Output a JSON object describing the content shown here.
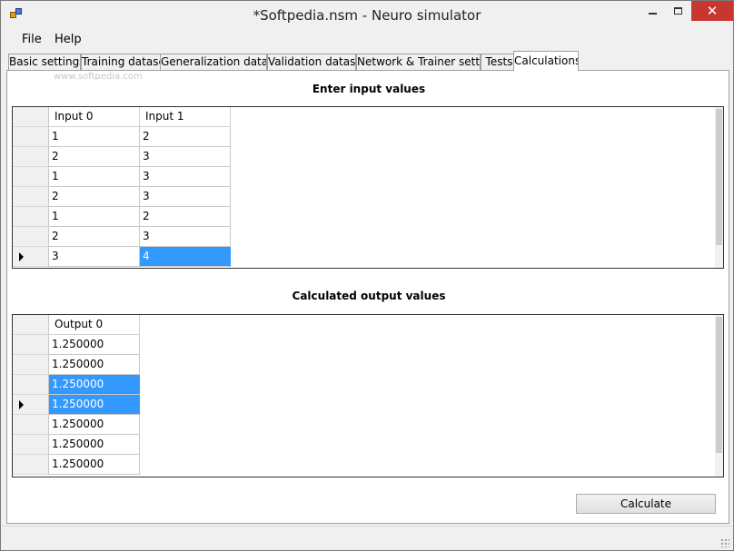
{
  "window": {
    "title": "*Softpedia.nsm - Neuro simulator"
  },
  "menu": [
    {
      "label": "File"
    },
    {
      "label": "Help"
    }
  ],
  "tabs": [
    {
      "label": "Basic settings"
    },
    {
      "label": "Training dataset"
    },
    {
      "label": "Generalization dataset"
    },
    {
      "label": "Validation dataset"
    },
    {
      "label": "Network & Trainer settings"
    },
    {
      "label": "Tests"
    },
    {
      "label": "Calculations",
      "active": true
    }
  ],
  "watermark": "www.softpedia.com",
  "input_section": {
    "title": "Enter input values",
    "columns": [
      "Input 0",
      "Input 1"
    ],
    "rows": [
      [
        "1",
        "2"
      ],
      [
        "2",
        "3"
      ],
      [
        "1",
        "3"
      ],
      [
        "2",
        "3"
      ],
      [
        "1",
        "2"
      ],
      [
        "2",
        "3"
      ],
      [
        "3",
        "4"
      ]
    ]
  },
  "output_section": {
    "title": "Calculated output values",
    "columns": [
      "Output 0"
    ],
    "rows": [
      [
        "1.250000"
      ],
      [
        "1.250000"
      ],
      [
        "1.250000"
      ],
      [
        "1.250000"
      ],
      [
        "1.250000"
      ],
      [
        "1.250000"
      ],
      [
        "1.250000"
      ]
    ]
  },
  "calculate_button": "Calculate",
  "colors": {
    "selection": "#3399ff",
    "close_button": "#c7372f"
  }
}
